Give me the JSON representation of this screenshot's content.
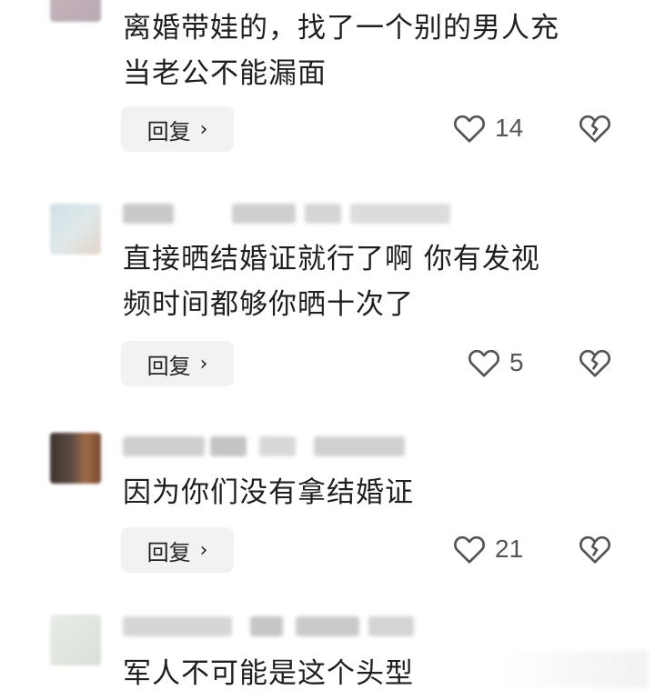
{
  "comments": [
    {
      "text": "离婚带娃的，找了一个别的男人充\n当老公不能漏面",
      "reply_label": "回复",
      "reply_chevron": "›",
      "likes": "14",
      "avatar_colors": [
        "#c8b6bd",
        "#b9a9b3"
      ]
    },
    {
      "text": "直接晒结婚证就行了啊 你有发视\n频时间都够你晒十次了",
      "reply_label": "回复",
      "reply_chevron": "›",
      "likes": "5",
      "avatar_colors": [
        "#cfe0e6",
        "#e4d6c8"
      ]
    },
    {
      "text": "因为你们没有拿结婚证",
      "reply_label": "回复",
      "reply_chevron": "›",
      "likes": "21",
      "avatar_colors": [
        "#4b3a34",
        "#8a5a3c"
      ]
    },
    {
      "text": "军人不可能是这个头型",
      "avatar_colors": [
        "#e8ece6",
        "#d9dfd6"
      ]
    }
  ],
  "icons": {
    "like": "heart-outline-icon",
    "dislike": "broken-heart-icon"
  },
  "colors": {
    "icon_stroke": "#555555",
    "reply_bg": "#f2f2f2",
    "text": "#1f1f1f"
  }
}
